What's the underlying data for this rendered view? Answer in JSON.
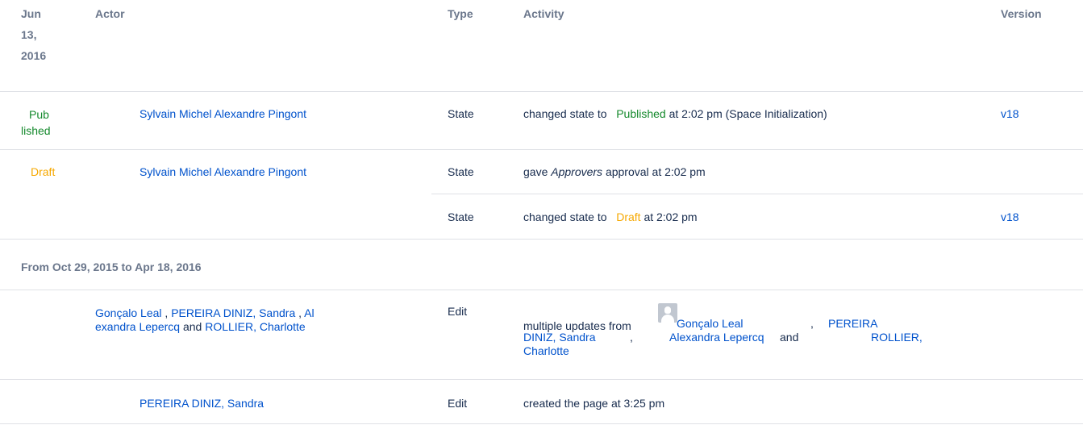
{
  "header": {
    "date_line1": "Jun",
    "date_line2": "13,",
    "date_line3": "2016",
    "actor": "Actor",
    "type": "Type",
    "activity": "Activity",
    "version": "Version"
  },
  "rows": {
    "r1": {
      "status_line1": "Pub",
      "status_line2": "lished",
      "actor": "Sylvain Michel Alexandre Pingont",
      "type": "State",
      "activity_prefix": "changed state to",
      "activity_state": "Published",
      "activity_suffix": "at 2:02 pm (Space Initialization)",
      "version": "v18"
    },
    "r2": {
      "status": "Draft",
      "actor": "Sylvain Michel Alexandre Pingont",
      "type": "State",
      "activity_prefix": "gave",
      "activity_group": "Approvers",
      "activity_suffix": "approval at 2:02 pm"
    },
    "r3": {
      "type": "State",
      "activity_prefix": "changed state to",
      "activity_state": "Draft",
      "activity_suffix": "at 2:02 pm",
      "version": "v18"
    }
  },
  "range_label": "From Oct 29, 2015 to Apr 18, 2016",
  "rows2": {
    "r4": {
      "actor1": "Gonçalo Leal",
      "sep1": ",",
      "actor2": "PEREIRA DINIZ, Sandra",
      "sep2": ",",
      "actor3_line1": "Al",
      "actor3_line2": "exandra Lepercq",
      "and": "and",
      "actor4": "ROLLIER, Charlotte",
      "type": "Edit",
      "activity_prefix": "multiple updates from",
      "u1": "Gonçalo Leal",
      "comma1": ",",
      "u2_line1": "PEREIRA",
      "u2_line2": "DINIZ, Sandra",
      "comma2": ",",
      "u3": "Alexandra Lepercq",
      "u4_line1": "ROLLIER,",
      "u4_line2": "Charlotte"
    },
    "r5": {
      "actor": "PEREIRA DINIZ, Sandra",
      "type": "Edit",
      "activity": "created the page at 3:25 pm"
    }
  }
}
